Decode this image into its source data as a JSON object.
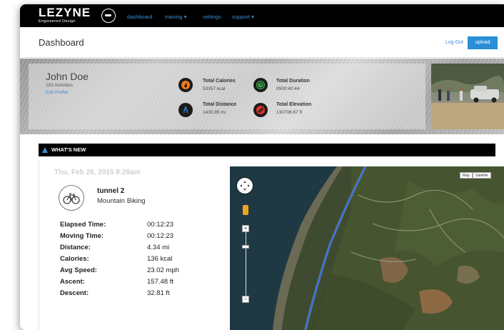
{
  "brand": {
    "name": "LEZYNE",
    "tagline": "Engineered Design"
  },
  "nav": {
    "items": [
      {
        "label": "dashboard"
      },
      {
        "label": "training ▾"
      },
      {
        "label": "settings"
      },
      {
        "label": "support ▾"
      }
    ]
  },
  "header": {
    "title": "Dashboard",
    "logout_label": "Log Out",
    "upload_label": "upload"
  },
  "profile": {
    "name": "John Doe",
    "activities": "153 Activities",
    "edit_label": "Edit Profile"
  },
  "stats": [
    {
      "label": "Total Calories",
      "value": "53357 kcal",
      "icon": "flame-icon",
      "color": "#f27b1a"
    },
    {
      "label": "Total Duration",
      "value": "0500:40:44",
      "icon": "clock-icon",
      "color": "#3bb54a"
    },
    {
      "label": "Total Distance",
      "value": "1430.95 mi",
      "icon": "rider-icon",
      "color": "#2f8ad6"
    },
    {
      "label": "Total Elevation",
      "value": "130708.67 ft",
      "icon": "elevation-icon",
      "color": "#e8322b"
    }
  ],
  "whats_new": {
    "title": "WHAT'S NEW"
  },
  "activity": {
    "date": "Thu, Feb 26, 2015 8:26am",
    "name": "tunnel 2",
    "type": "Mountain Biking",
    "icon": "bicycle-icon",
    "rows": [
      {
        "label": "Elapsed Time:",
        "value": "00:12:23"
      },
      {
        "label": "Moving Time:",
        "value": "00:12:23"
      },
      {
        "label": "Distance:",
        "value": "4.34 mi"
      },
      {
        "label": "Calories:",
        "value": "136 kcal"
      },
      {
        "label": "Avg Speed:",
        "value": "23.02 mph"
      },
      {
        "label": "Ascent:",
        "value": "157.48 ft"
      },
      {
        "label": "Descent:",
        "value": "32.81 ft"
      }
    ]
  },
  "map": {
    "map_label": "Map",
    "satellite_label": "Satellite",
    "zoom_in": "+",
    "zoom_out": "−"
  },
  "colors": {
    "accent": "#2a8fd6",
    "nav_bg": "#000000",
    "route": "#3a6fd6"
  }
}
